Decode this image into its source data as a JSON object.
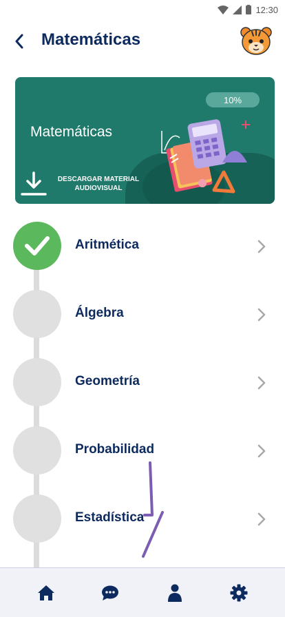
{
  "status_bar": {
    "time": "12:30"
  },
  "header": {
    "title": "Matemáticas"
  },
  "banner": {
    "title": "Matemáticas",
    "progress_text": "10%",
    "progress_value": 0.1,
    "download_label_line1": "DESCARGAR MATERIAL",
    "download_label_line2": "AUDIOVISUAL"
  },
  "topics": [
    {
      "label": "Aritmética",
      "completed": true
    },
    {
      "label": "Álgebra",
      "completed": false
    },
    {
      "label": "Geometría",
      "completed": false
    },
    {
      "label": "Probabilidad",
      "completed": false
    },
    {
      "label": "Estadística",
      "completed": false
    }
  ],
  "bottom_nav": [
    {
      "icon": "home-icon"
    },
    {
      "icon": "chat-icon"
    },
    {
      "icon": "profile-icon"
    },
    {
      "icon": "settings-icon"
    }
  ],
  "colors": {
    "primary": "#0d2a5e",
    "banner": "#1f7a6b",
    "completed": "#5cb85c",
    "pending": "#e0e0e0"
  }
}
